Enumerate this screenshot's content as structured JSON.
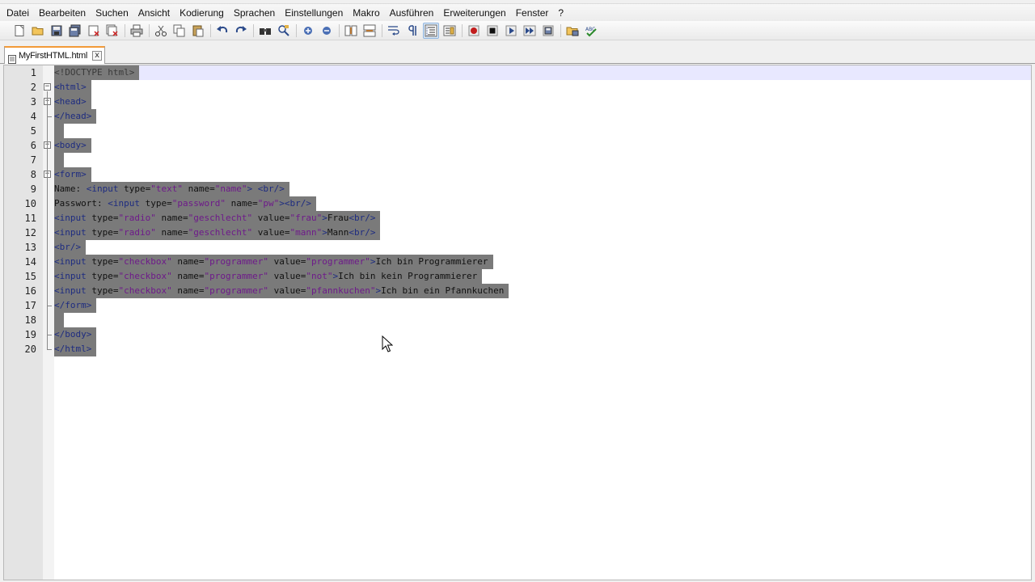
{
  "menu": [
    "Datei",
    "Bearbeiten",
    "Suchen",
    "Ansicht",
    "Kodierung",
    "Sprachen",
    "Einstellungen",
    "Makro",
    "Ausführen",
    "Erweiterungen",
    "Fenster",
    "?"
  ],
  "tab": {
    "label": "MyFirstHTML.html",
    "close_label": "x"
  },
  "accent_color": "#f29a38",
  "selection_color": "#7a7a7a",
  "toolbar_icons": [
    "new-file-icon",
    "open-file-icon",
    "save-icon",
    "save-all-icon",
    "close-icon",
    "close-all-icon",
    "print-icon",
    "cut-icon",
    "copy-icon",
    "paste-icon",
    "undo-icon",
    "redo-icon",
    "find-icon",
    "replace-icon",
    "zoom-in-icon",
    "zoom-out-icon",
    "sync-vertical-icon",
    "sync-horizontal-icon",
    "word-wrap-icon",
    "show-all-chars-icon",
    "indent-guide-icon",
    "document-map-icon",
    "record-macro-icon",
    "stop-macro-icon",
    "play-macro-icon",
    "run-macro-multiple-icon",
    "save-macro-icon",
    "open-folder-icon",
    "spellcheck-icon"
  ],
  "lines": [
    {
      "n": "1",
      "text": "<!DOCTYPE html>"
    },
    {
      "n": "2",
      "text": "<html>"
    },
    {
      "n": "3",
      "text": "<head>"
    },
    {
      "n": "4",
      "text": "</head>"
    },
    {
      "n": "5",
      "text": ""
    },
    {
      "n": "6",
      "text": "<body>"
    },
    {
      "n": "7",
      "text": ""
    },
    {
      "n": "8",
      "text": "<form>"
    },
    {
      "n": "9",
      "text": "Name: <input type=\"text\" name=\"name\"> <br/>"
    },
    {
      "n": "10",
      "text": "Passwort: <input type=\"password\" name=\"pw\"><br/>"
    },
    {
      "n": "11",
      "text": "<input type=\"radio\" name=\"geschlecht\" value=\"frau\">Frau<br/>"
    },
    {
      "n": "12",
      "text": "<input type=\"radio\" name=\"geschlecht\" value=\"mann\">Mann<br/>"
    },
    {
      "n": "13",
      "text": "<br/>"
    },
    {
      "n": "14",
      "text": "<input type=\"checkbox\" name=\"programmer\" value=\"programmer\">Ich bin Programmierer"
    },
    {
      "n": "15",
      "text": "<input type=\"checkbox\" name=\"programmer\" value=\"not\">Ich bin kein Programmierer"
    },
    {
      "n": "16",
      "text": "<input type=\"checkbox\" name=\"programmer\" value=\"pfannkuchen\">Ich bin ein Pfannkuchen"
    },
    {
      "n": "17",
      "text": "</form>"
    },
    {
      "n": "18",
      "text": ""
    },
    {
      "n": "19",
      "text": "</body>"
    },
    {
      "n": "20",
      "text": "</html>"
    }
  ]
}
